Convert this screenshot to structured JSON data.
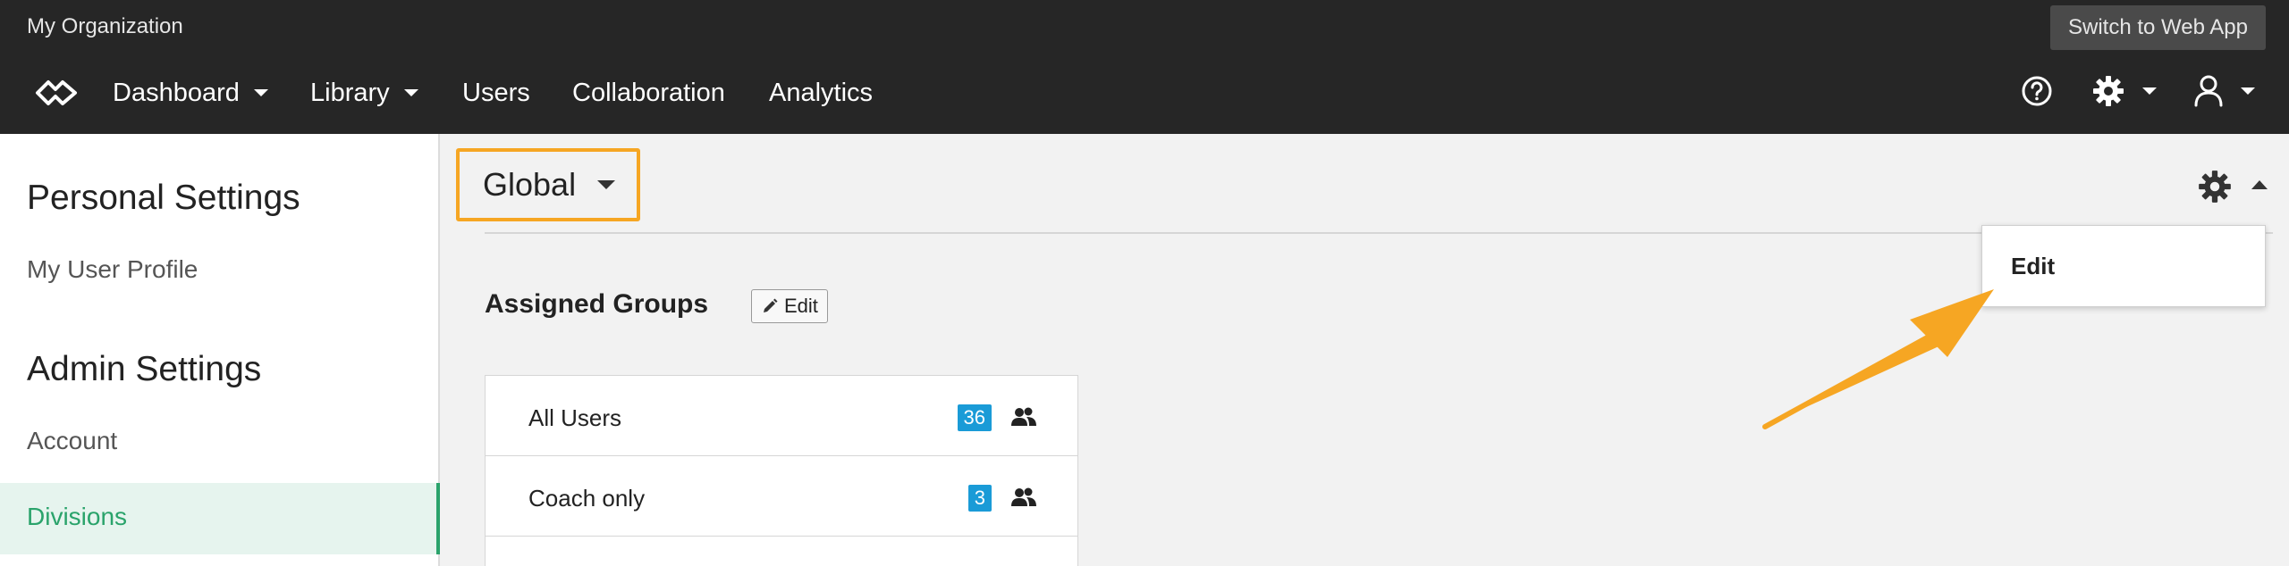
{
  "org": {
    "name": "My Organization"
  },
  "header": {
    "switch_label": "Switch to Web App",
    "nav": [
      {
        "label": "Dashboard",
        "has_caret": true
      },
      {
        "label": "Library",
        "has_caret": true
      },
      {
        "label": "Users",
        "has_caret": false
      },
      {
        "label": "Collaboration",
        "has_caret": false
      },
      {
        "label": "Analytics",
        "has_caret": false
      }
    ],
    "icons": [
      "help-icon",
      "gear-icon",
      "user-icon"
    ]
  },
  "sidebar": {
    "personal_heading": "Personal Settings",
    "personal_items": [
      "My User Profile"
    ],
    "admin_heading": "Admin Settings",
    "admin_items": [
      "Account",
      "Divisions"
    ],
    "active_item": "Divisions"
  },
  "main": {
    "division_selector": "Global",
    "settings_menu": {
      "items": [
        "Edit"
      ]
    },
    "assigned_groups": {
      "title": "Assigned Groups",
      "edit_label": "Edit",
      "rows": [
        {
          "name": "All Users",
          "count": "36"
        },
        {
          "name": "Coach only",
          "count": "3"
        }
      ]
    }
  },
  "colors": {
    "topbar": "#262626",
    "accent_green": "#2aa36b",
    "highlight_orange": "#f6a623",
    "badge_blue": "#1a9bd7"
  }
}
